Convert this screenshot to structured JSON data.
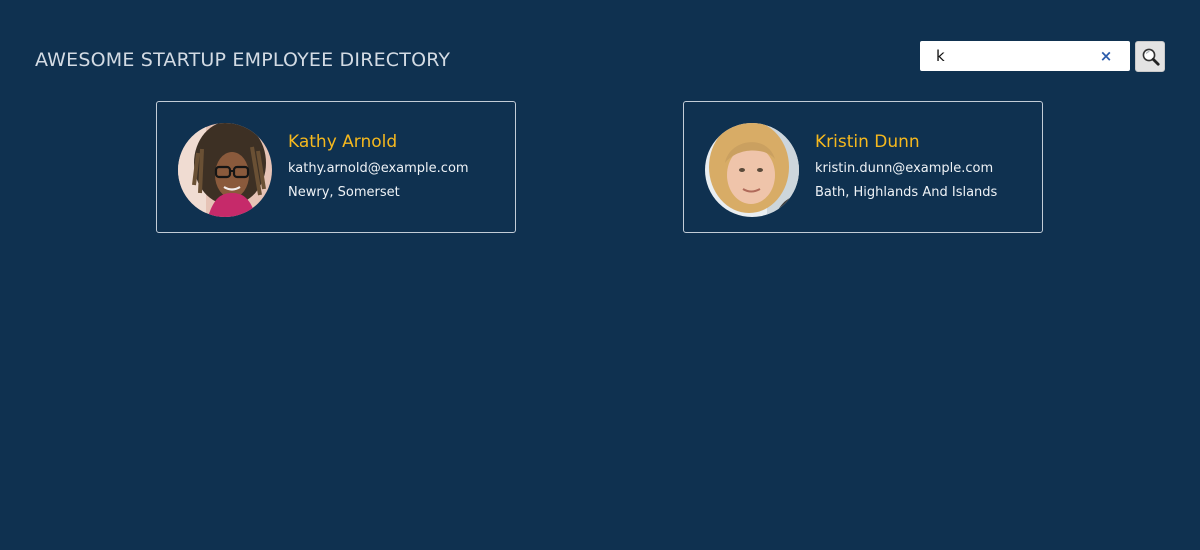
{
  "header": {
    "title": "AWESOME STARTUP EMPLOYEE DIRECTORY"
  },
  "search": {
    "value": "k",
    "clear_icon": "×",
    "icon_name": "search-icon"
  },
  "colors": {
    "background": "#0f3150",
    "name": "#f5b81e",
    "text": "#eef2f6",
    "card_border": "#c2ccd7"
  },
  "employees": [
    {
      "name": "Kathy Arnold",
      "email": "kathy.arnold@example.com",
      "location": "Newry, Somerset"
    },
    {
      "name": "Kristin Dunn",
      "email": "kristin.dunn@example.com",
      "location": "Bath, Highlands And Islands"
    }
  ]
}
